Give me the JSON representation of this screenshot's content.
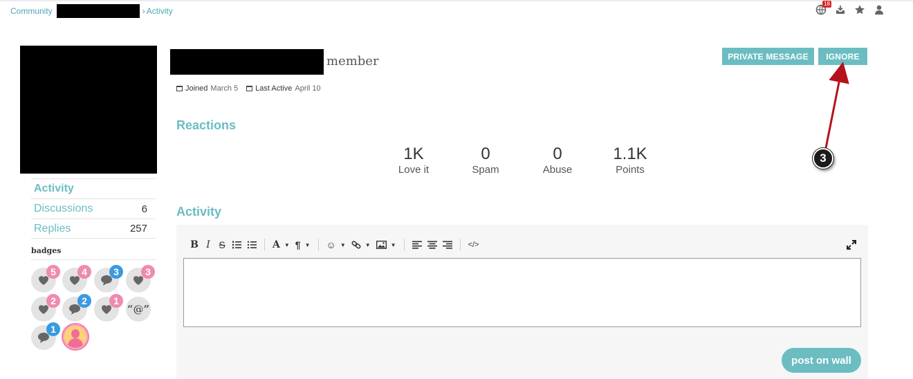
{
  "breadcrumb": {
    "root": "Community",
    "separator": "›",
    "current": "Activity"
  },
  "header_icons": {
    "notifications_count": "18",
    "icons": [
      "globe-icon",
      "inbox-icon",
      "star-icon",
      "user-icon"
    ]
  },
  "profile": {
    "role": "member",
    "joined_label": "Joined",
    "joined_value": "March 5",
    "last_active_label": "Last Active",
    "last_active_value": "April 10"
  },
  "actions": {
    "private_message": "PRIVATE MESSAGE",
    "ignore": "IGNORE"
  },
  "annotation": {
    "step": "3",
    "color": "#b5121b"
  },
  "reactions": {
    "heading": "Reactions",
    "stats": [
      {
        "value": "1K",
        "label": "Love it"
      },
      {
        "value": "0",
        "label": "Spam"
      },
      {
        "value": "0",
        "label": "Abuse"
      },
      {
        "value": "1.1K",
        "label": "Points"
      }
    ]
  },
  "sidebar": {
    "items": [
      {
        "label": "Activity",
        "count": ""
      },
      {
        "label": "Discussions",
        "count": "6"
      },
      {
        "label": "Replies",
        "count": "257"
      }
    ],
    "badges_label": "badges",
    "badges": [
      {
        "icon": "heart-icon",
        "count": "5",
        "color": "pink"
      },
      {
        "icon": "heart-icon",
        "count": "4",
        "color": "pink"
      },
      {
        "icon": "comment-icon",
        "count": "3",
        "color": "blue"
      },
      {
        "icon": "heart-icon",
        "count": "3",
        "color": "pink"
      },
      {
        "icon": "heart-icon",
        "count": "2",
        "color": "pink"
      },
      {
        "icon": "comment-icon",
        "count": "2",
        "color": "blue"
      },
      {
        "icon": "heart-icon",
        "count": "1",
        "color": "pink"
      },
      {
        "icon": "mention-icon",
        "text": "“@”"
      },
      {
        "icon": "comment-icon",
        "count": "1",
        "color": "blue"
      },
      {
        "icon": "avatar-icon"
      }
    ]
  },
  "activity": {
    "heading": "Activity",
    "toolbar": {
      "bold": "B",
      "italic": "I",
      "strike": "S",
      "font": "A",
      "paragraph": "¶",
      "emoji": "☺",
      "code": "</>"
    },
    "post_button": "post on wall"
  },
  "colors": {
    "accent": "#6bbdc2",
    "pink_badge": "#ef8ab0",
    "blue_badge": "#3a9ae0",
    "notif_red": "#d9262a"
  }
}
